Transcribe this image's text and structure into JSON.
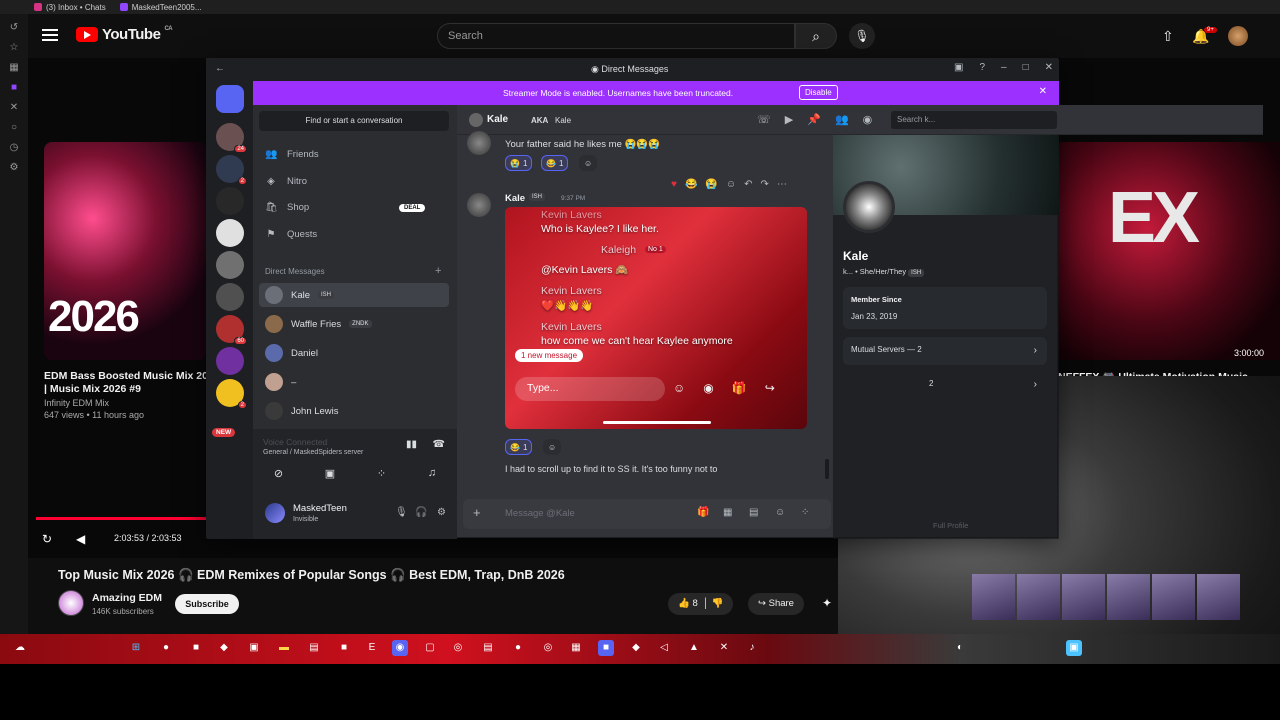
{
  "browser_tabs": [
    "(3) Inbox • Chats",
    "MaskedTeen2005..."
  ],
  "youtube": {
    "logo": "YouTube",
    "region": "CA",
    "search_placeholder": "Search",
    "notif_badge": "9+",
    "left_video": {
      "thumb_text": "2026",
      "title": "EDM Bass Boosted Music Mix 2026 | Music Mix 2026 #9",
      "channel": "Infinity EDM Mix",
      "meta": "647 views • 11 hours ago"
    },
    "right_video": {
      "thumb_text": "EX",
      "duration": "3:00:00",
      "title": "NEFFEX 🎮 Ultimate Motivation Music"
    },
    "player_time": "2:03:53 / 2:03:53",
    "video_title": "Top Music Mix 2026 🎧 EDM Remixes of Popular Songs 🎧 Best EDM, Trap, DnB 2026",
    "channel_name": "Amazing EDM",
    "channel_subs": "146K subscribers",
    "subscribe_label": "Subscribe",
    "like_count": "8",
    "share_label": "Share"
  },
  "discord": {
    "window_title": "Direct Messages",
    "banner": {
      "text": "Streamer Mode is enabled. Usernames have been truncated.",
      "button": "Disable"
    },
    "server_badges": [
      "24",
      "2",
      "60",
      "2"
    ],
    "new_badge": "NEW",
    "find_placeholder": "Find or start a conversation",
    "nav": [
      "Friends",
      "Nitro",
      "Shop",
      "Quests"
    ],
    "shop_badge": "DEAL",
    "dm_header": "Direct Messages",
    "dms": [
      {
        "name": "Kale",
        "tag": "ISH"
      },
      {
        "name": "Waffle Fries",
        "tag": "ZNDK"
      },
      {
        "name": "Daniel",
        "tag": ""
      },
      {
        "name": "–",
        "tag": ""
      },
      {
        "name": "John Lewis",
        "tag": ""
      }
    ],
    "voice": {
      "status": "Voice Connected",
      "channel": "General / MaskedSpiders server"
    },
    "user": {
      "name": "MaskedTeen",
      "status": "Invisible"
    },
    "chat": {
      "header_name": "Kale",
      "aka_label": "AKA",
      "aka_name": "Kale",
      "search_placeholder": "Search k...",
      "message1": "Your father said he likes me 😭😭😭",
      "reactions1": [
        {
          "emoji": "😭",
          "count": "1"
        },
        {
          "emoji": "😂",
          "count": "1"
        }
      ],
      "author": "Kale",
      "author_tag": "ISH",
      "time": "9:37 PM",
      "screenshot": {
        "line1_name": "Kevin Lavers",
        "line1_text": "Who is Kaylee? I like her.",
        "line2_name": "Kaleigh",
        "line2_tag": "No 1",
        "line2_text": "@Kevin Lavers 🙈",
        "line3_name": "Kevin Lavers",
        "line3_text": "❤️👋👋👋",
        "line4_name": "Kevin Lavers",
        "line4_text": "how come we can't hear Kaylee anymore",
        "new_message": "1 new message",
        "type_placeholder": "Type..."
      },
      "reactions2": [
        {
          "emoji": "😂",
          "count": "1"
        }
      ],
      "message2": "I had to scroll up to find it to SS it. It's too funny not to",
      "composer_placeholder": "Message @Kale"
    },
    "profile": {
      "name": "Kale",
      "subline": "k... • She/Her/They",
      "tag": "ISH",
      "member_since_label": "Member Since",
      "member_since": "Jan 23, 2019",
      "mutual_servers": "Mutual Servers — 2",
      "mutual_friends_count": "2",
      "full_profile": "Full Profile"
    }
  },
  "colors": {
    "yt_red": "#ff0000",
    "discord_blurple": "#5865f2",
    "streamer_banner": "#9b30ff"
  }
}
